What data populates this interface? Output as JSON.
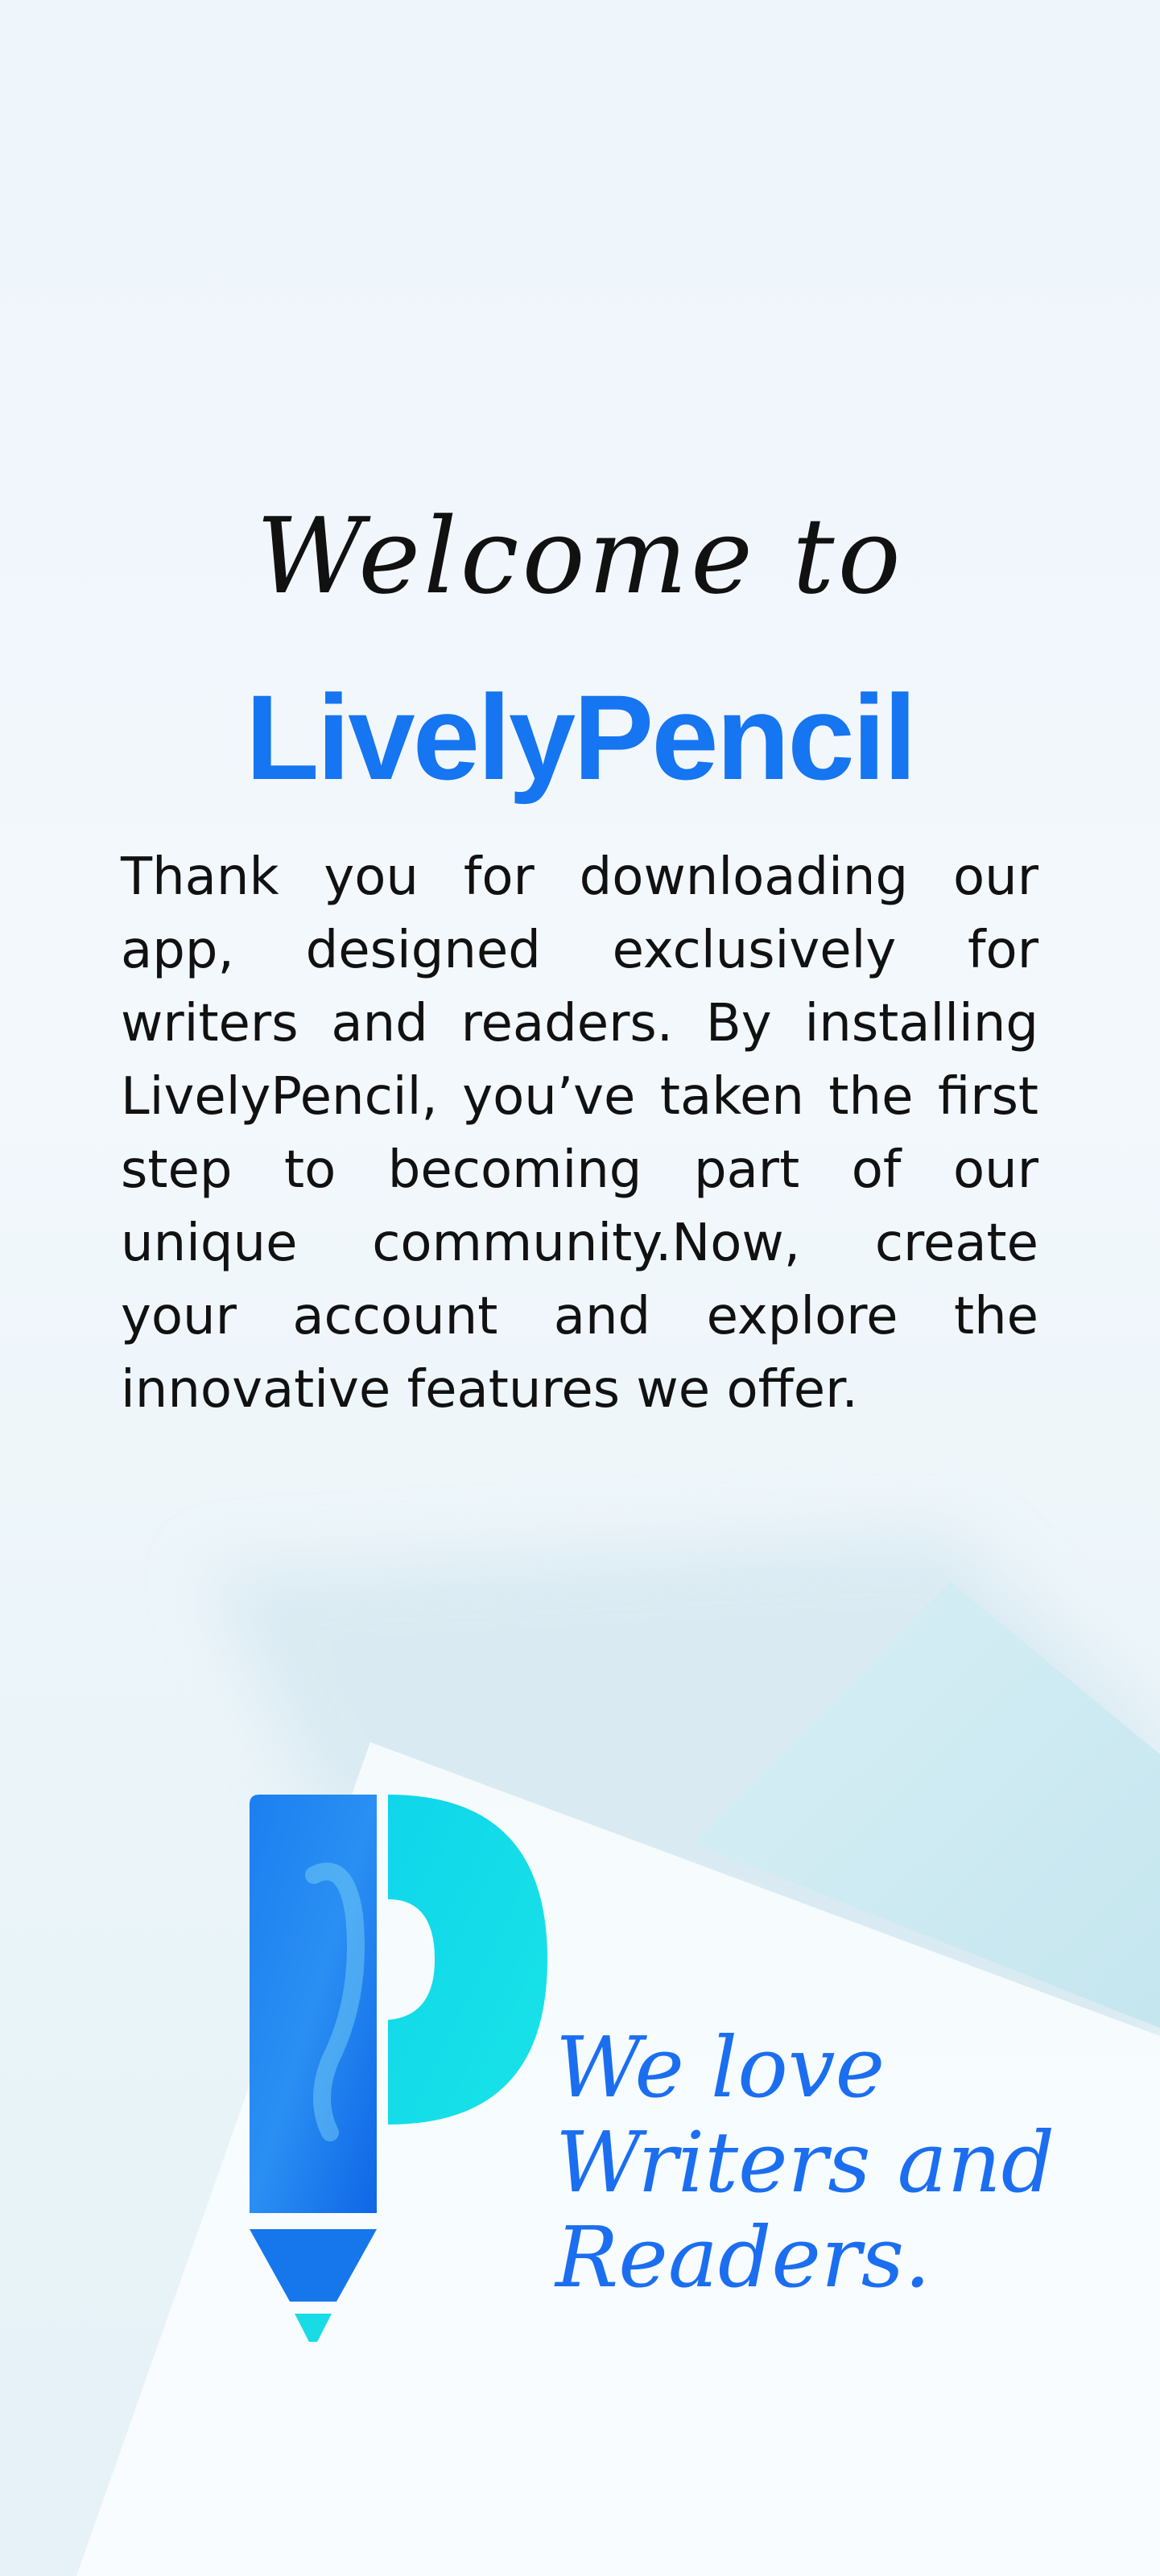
{
  "welcome_text": "Welcome to",
  "brand_name": "LivelyPencil",
  "intro_text": "Thank you for downloading our app, designed exclusively for writers and readers. By installing LivelyPencil, you’ve taken the first step to becoming part of our unique community.Now, create your account and explore the innovative features we offer.",
  "tagline": {
    "line1": "We love",
    "line2": "Writers and",
    "line3": "Readers."
  },
  "colors": {
    "brand": "#1675f0",
    "tagline": "#1b6ef0",
    "logo_blue": "#1778ee",
    "logo_cyan": "#15dce8"
  },
  "icons": {
    "logo": "pencil-p-logo"
  }
}
